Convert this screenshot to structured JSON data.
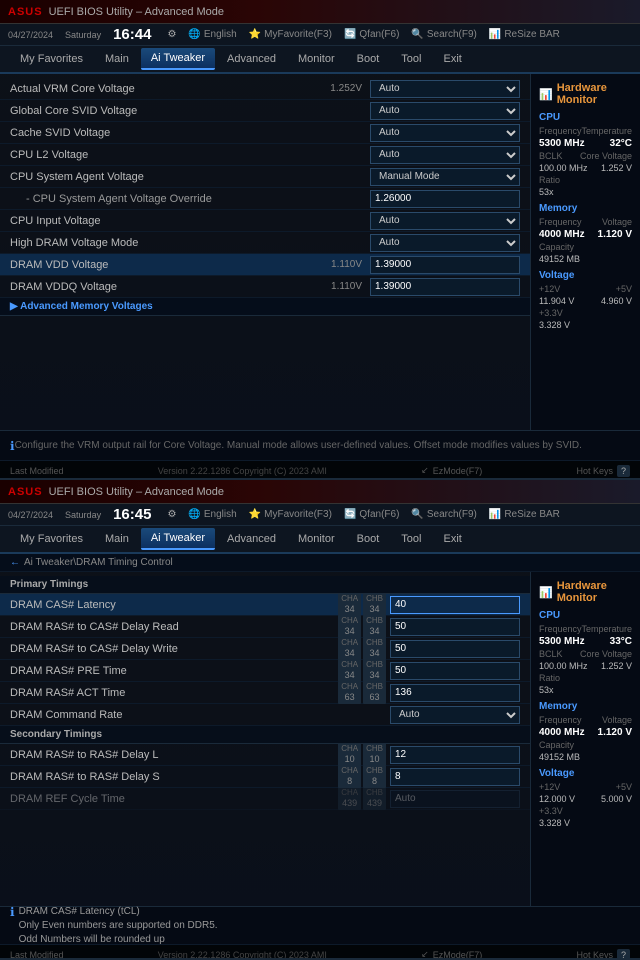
{
  "panel1": {
    "asus_logo": "ASUS",
    "title": "UEFI BIOS Utility – Advanced Mode",
    "date": "04/27/2024",
    "day": "Saturday",
    "time": "16:44",
    "settings_icon": "⚙",
    "toolbar": [
      {
        "icon": "🌐",
        "label": "English"
      },
      {
        "icon": "⭐",
        "label": "MyFavorite(F3)"
      },
      {
        "icon": "🔄",
        "label": "Qfan(F6)"
      },
      {
        "icon": "🔍",
        "label": "Search(F9)"
      },
      {
        "icon": "📊",
        "label": "ReSize BAR"
      }
    ],
    "nav_items": [
      "My Favorites",
      "Main",
      "Ai Tweaker",
      "Advanced",
      "Monitor",
      "Boot",
      "Tool",
      "Exit"
    ],
    "active_nav": "Ai Tweaker",
    "settings": [
      {
        "label": "Actual VRM Core Voltage",
        "current": "1.252V",
        "control": "select",
        "value": "Auto"
      },
      {
        "label": "Global Core SVID Voltage",
        "current": "",
        "control": "select",
        "value": "Auto"
      },
      {
        "label": "Cache SVID Voltage",
        "current": "",
        "control": "select",
        "value": "Auto"
      },
      {
        "label": "CPU L2 Voltage",
        "current": "",
        "control": "select",
        "value": "Auto"
      },
      {
        "label": "CPU System Agent Voltage",
        "current": "",
        "control": "select",
        "value": "Manual Mode"
      },
      {
        "label": "- CPU System Agent Voltage Override",
        "current": "",
        "control": "input",
        "value": "1.26000",
        "indented": true
      },
      {
        "label": "CPU Input Voltage",
        "current": "",
        "control": "select",
        "value": "Auto"
      },
      {
        "label": "High DRAM Voltage Mode",
        "current": "",
        "control": "select",
        "value": "Auto"
      },
      {
        "label": "DRAM VDD Voltage",
        "current": "1.110V",
        "control": "input",
        "value": "1.39000"
      },
      {
        "label": "DRAM VDDQ Voltage",
        "current": "1.110V",
        "control": "input",
        "value": "1.39000"
      }
    ],
    "advanced_memory_voltages": "▶ Advanced Memory Voltages",
    "status_text": "Configure the VRM output rail for Core Voltage. Manual mode allows user-defined values. Offset mode modifies values by SVID.",
    "sidebar": {
      "title": "Hardware Monitor",
      "monitor_icon": "📊",
      "sections": [
        {
          "title": "CPU",
          "rows": [
            {
              "label": "Frequency",
              "value": "Temperature"
            },
            {
              "label": "5300 MHz",
              "value": "32°C"
            },
            {
              "label": "BCLK",
              "value": "Core Voltage"
            },
            {
              "label": "100.00 MHz",
              "value": "1.252 V"
            },
            {
              "label": "Ratio",
              "value": ""
            },
            {
              "label": "53x",
              "value": ""
            }
          ]
        },
        {
          "title": "Memory",
          "rows": [
            {
              "label": "Frequency",
              "value": "Voltage"
            },
            {
              "label": "4000 MHz",
              "value": "1.120 V"
            },
            {
              "label": "Capacity",
              "value": ""
            },
            {
              "label": "49152 MB",
              "value": ""
            }
          ]
        },
        {
          "title": "Voltage",
          "rows": [
            {
              "label": "+12V",
              "value": "+5V"
            },
            {
              "label": "11.904 V",
              "value": "4.960 V"
            },
            {
              "label": "+3.3V",
              "value": ""
            },
            {
              "label": "3.328 V",
              "value": ""
            }
          ]
        }
      ]
    }
  },
  "panel2": {
    "asus_logo": "ASUS",
    "title": "UEFI BIOS Utility – Advanced Mode",
    "date": "04/27/2024",
    "day": "Saturday",
    "time": "16:45",
    "settings_icon": "⚙",
    "breadcrumb": "Ai Tweaker\\DRAM Timing Control",
    "nav_items": [
      "My Favorites",
      "Main",
      "Ai Tweaker",
      "Advanced",
      "Monitor",
      "Boot",
      "Tool",
      "Exit"
    ],
    "active_nav": "Ai Tweaker",
    "section_primary": "Primary Timings",
    "section_secondary": "Secondary Timings",
    "settings": [
      {
        "label": "DRAM CAS# Latency",
        "cha": "34",
        "chb": "34",
        "value": "40",
        "active": true
      },
      {
        "label": "DRAM RAS# to CAS# Delay Read",
        "cha": "34",
        "chb": "34",
        "value": "50"
      },
      {
        "label": "DRAM RAS# to CAS# Delay Write",
        "cha": "34",
        "chb": "34",
        "value": "50"
      },
      {
        "label": "DRAM RAS# PRE Time",
        "cha": "34",
        "chb": "34",
        "value": "50"
      },
      {
        "label": "DRAM RAS# ACT Time",
        "cha": "63",
        "chb": "63",
        "value": "136"
      },
      {
        "label": "DRAM Command Rate",
        "cha": "",
        "chb": "",
        "value": "Auto",
        "control": "select"
      }
    ],
    "secondary_settings": [
      {
        "label": "DRAM RAS# to RAS# Delay L",
        "cha": "10",
        "chb": "10",
        "value": "12"
      },
      {
        "label": "DRAM RAS# to RAS# Delay S",
        "cha": "8",
        "chb": "8",
        "value": "8"
      },
      {
        "label": "DRAM REF Cycle Time",
        "cha": "439",
        "chb": "439",
        "value": "Auto",
        "disabled": true
      }
    ],
    "status_text": "DRAM CAS# Latency (tCL)\nOnly Even numbers are supported on DDR5.\nOdd Numbers will be rounded up",
    "sidebar": {
      "title": "Hardware Monitor",
      "sections": [
        {
          "title": "CPU",
          "rows": [
            {
              "label": "Frequency",
              "value": "Temperature"
            },
            {
              "label": "5300 MHz",
              "value": "33°C"
            },
            {
              "label": "BCLK",
              "value": "Core Voltage"
            },
            {
              "label": "100.00 MHz",
              "value": "1.252 V"
            },
            {
              "label": "Ratio",
              "value": ""
            },
            {
              "label": "53x",
              "value": ""
            }
          ]
        },
        {
          "title": "Memory",
          "rows": [
            {
              "label": "Frequency",
              "value": "Voltage"
            },
            {
              "label": "4000 MHz",
              "value": "1.120 V"
            },
            {
              "label": "Capacity",
              "value": ""
            },
            {
              "label": "49152 MB",
              "value": ""
            }
          ]
        },
        {
          "title": "Voltage",
          "rows": [
            {
              "label": "+12V",
              "value": "+5V"
            },
            {
              "label": "12.000 V",
              "value": "5.000 V"
            },
            {
              "label": "+3.3V",
              "value": ""
            },
            {
              "label": "3.328 V",
              "value": ""
            }
          ]
        }
      ]
    }
  },
  "footer": {
    "last_modified": "Last Modified",
    "ez_mode": "EzMode(F7)",
    "ez_icon": "↙",
    "hot_keys": "Hot Keys",
    "hot_keys_badge": "?",
    "copyright": "Version 2.22.1286 Copyright (C) 2023 AMI"
  }
}
